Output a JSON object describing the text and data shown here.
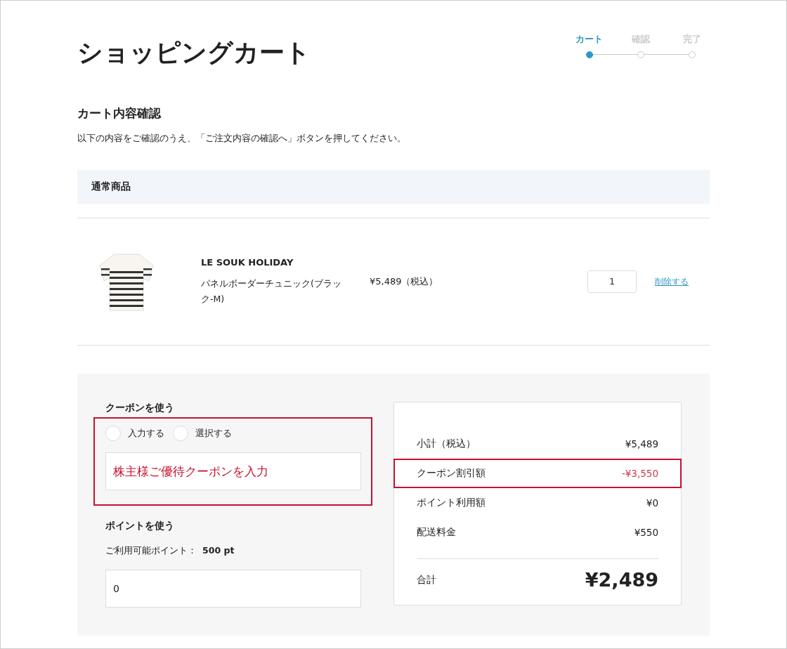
{
  "title": "ショッピングカート",
  "steps": [
    {
      "label": "カート",
      "selected": true
    },
    {
      "label": "確認",
      "selected": false
    },
    {
      "label": "完了",
      "selected": false
    }
  ],
  "section_title": "カート内容確認",
  "instructions": "以下の内容をご確認のうえ、「ご注文内容の確認へ」ボタンを押してください。",
  "group_header": "通常商品",
  "items": [
    {
      "brand": "LE SOUK HOLIDAY",
      "name": "パネルボーダーチュニック(ブラック-M)",
      "price": "¥5,489（税込）",
      "quantity": "1",
      "remove": "削除する"
    }
  ],
  "coupon": {
    "title": "クーポンを使う",
    "highlighted": true,
    "options": [
      {
        "label": "入力する",
        "selected": false
      },
      {
        "label": "選択する",
        "selected": false
      }
    ],
    "field_value": "株主様ご優待クーポンを入力"
  },
  "points": {
    "title": "ポイントを使う",
    "available_label": "ご利用可能ポイント：",
    "available_value": "500 pt",
    "field_value": "0"
  },
  "summary": {
    "rows": [
      {
        "label": "小計（税込）",
        "value": "¥5,489",
        "kind": "normal",
        "highlighted": false
      },
      {
        "label": "クーポン割引額",
        "value": "-¥3,550",
        "kind": "discount",
        "highlighted": true
      },
      {
        "label": "ポイント利用額",
        "value": "¥0",
        "kind": "normal",
        "highlighted": false
      },
      {
        "label": "配送料金",
        "value": "¥550",
        "kind": "normal",
        "highlighted": false
      }
    ],
    "total_label": "合計",
    "total_value": "¥2,489"
  }
}
